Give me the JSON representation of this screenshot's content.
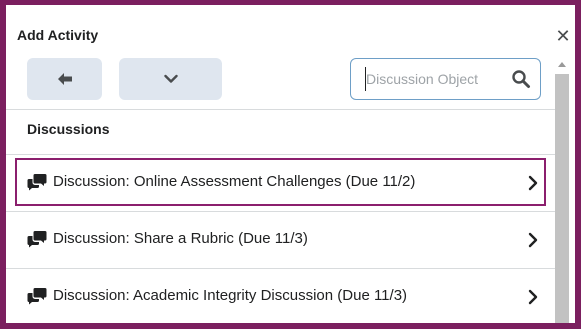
{
  "dialog": {
    "title": "Add Activity",
    "close_icon": "close-icon"
  },
  "toolbar": {
    "back_icon": "arrow-left-icon",
    "more_icon": "chevron-down-icon"
  },
  "search": {
    "placeholder": "Discussion Object",
    "value": "",
    "icon": "search-icon"
  },
  "section": {
    "title": "Discussions"
  },
  "items": [
    {
      "label": "Discussion: Online Assessment Challenges (Due 11/2)",
      "icon": "discussion-icon",
      "highlighted": true
    },
    {
      "label": "Discussion: Share a Rubric (Due 11/3)",
      "icon": "discussion-icon",
      "highlighted": false
    },
    {
      "label": "Discussion: Academic Integrity Discussion (Due 11/3)",
      "icon": "discussion-icon",
      "highlighted": false
    }
  ],
  "colors": {
    "frame": "#7b1f5f",
    "highlight": "#8b1f6d",
    "toolbar_button": "#dfe6ef",
    "search_border": "#6e9fc7"
  }
}
